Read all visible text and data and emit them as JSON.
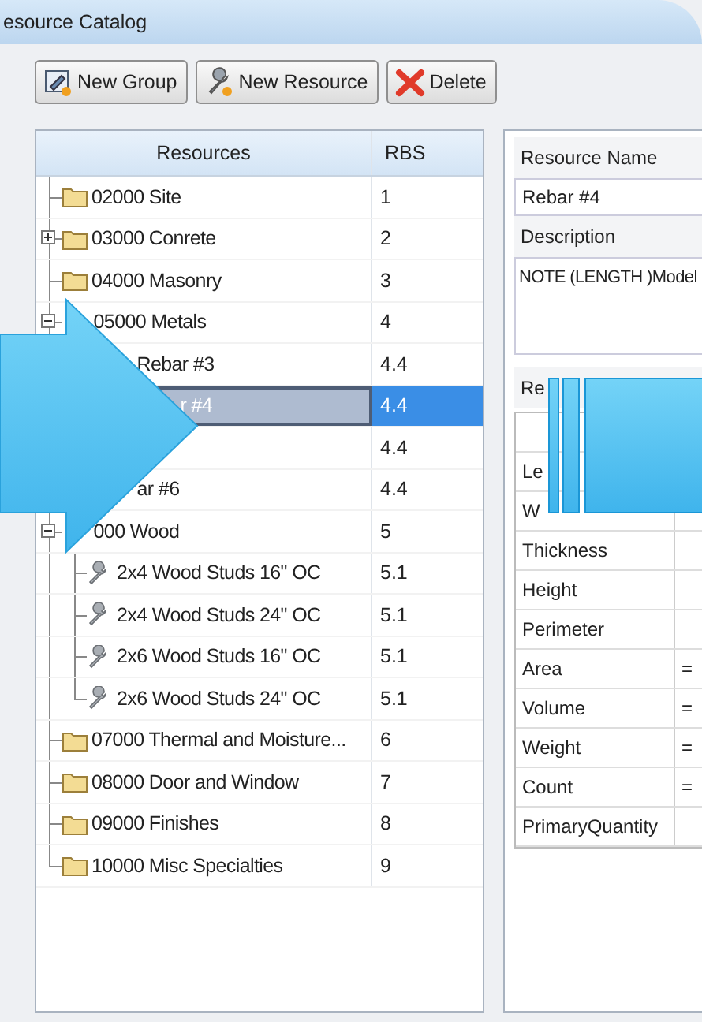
{
  "window": {
    "title": "esource Catalog"
  },
  "toolbar": [
    {
      "kind": "new-group",
      "label": "New Group"
    },
    {
      "kind": "new-resource",
      "label": "New Resource"
    },
    {
      "kind": "delete",
      "label": "Delete"
    }
  ],
  "tree": {
    "columns": [
      "Resources",
      "RBS"
    ],
    "items": [
      {
        "kind": "folder",
        "label": "02000 Site",
        "rbs": "1",
        "selected": false
      },
      {
        "kind": "folder",
        "label": "03000 Conrete",
        "rbs": "2",
        "selected": false,
        "expanded": false
      },
      {
        "kind": "folder",
        "label": "04000 Masonry",
        "rbs": "3",
        "selected": false
      },
      {
        "kind": "folder",
        "label": "05000 Metals",
        "rbs": "4",
        "selected": false,
        "expanded": true,
        "children": [
          {
            "label": "Rebar #3",
            "rbs": "4.4",
            "selected": false
          },
          {
            "label": "r #4",
            "rbs": "4.4",
            "selected": true
          },
          {
            "rbs": "4.4",
            "selected": false
          },
          {
            "label": "ar #6",
            "rbs": "4.4",
            "selected": false
          }
        ]
      },
      {
        "label": "000 Wood",
        "rbs": "5",
        "selected": false,
        "expanded": true,
        "children": [
          {
            "kind": "resource",
            "label": "2x4 Wood Studs 16\" OC",
            "rbs": "5.1",
            "selected": false
          },
          {
            "kind": "resource",
            "label": "2x4 Wood Studs 24\" OC",
            "rbs": "5.1",
            "selected": false
          },
          {
            "kind": "resource",
            "label": "2x6 Wood Studs 16\" OC",
            "rbs": "5.1",
            "selected": false
          },
          {
            "kind": "resource",
            "label": "2x6 Wood Studs 24\" OC",
            "rbs": "5.1",
            "selected": false
          }
        ]
      },
      {
        "kind": "folder",
        "label": "07000 Thermal and Moisture...",
        "rbs": "6",
        "selected": false
      },
      {
        "kind": "folder",
        "label": "08000 Door and Window",
        "rbs": "7",
        "selected": false
      },
      {
        "kind": "folder",
        "label": "09000 Finishes",
        "rbs": "8",
        "selected": false
      },
      {
        "kind": "folder",
        "label": "10000 Misc Specialties",
        "rbs": "9",
        "selected": false
      }
    ]
  },
  "details": {
    "name_label": "Resource Name",
    "name_value": "Rebar #4",
    "description_label": "Description",
    "description_value": "NOTE (LENGTH )Model",
    "calculations_label": "Re",
    "calculations": [
      {
        "name": "Le"
      },
      {
        "name": "W"
      },
      {
        "name": "Thickness"
      },
      {
        "name": "Height"
      },
      {
        "name": "Perimeter"
      },
      {
        "name": "Area",
        "value": "="
      },
      {
        "name": "Volume",
        "value": "="
      },
      {
        "name": "Weight",
        "value": "="
      },
      {
        "name": "Count",
        "value": "="
      },
      {
        "name": "PrimaryQuantity"
      }
    ]
  }
}
